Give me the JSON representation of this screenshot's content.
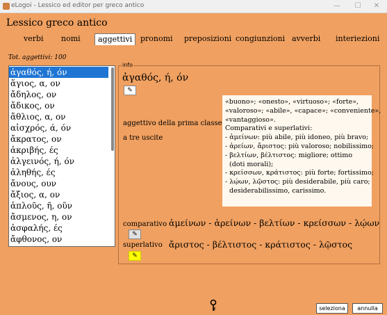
{
  "window": {
    "title": "eLogoi - Lessico ed editor per greco antico",
    "controls": [
      "—",
      "☐",
      "✕"
    ]
  },
  "page_title": "Lessico greco antico",
  "tabs": [
    {
      "label": "verbi",
      "active": false
    },
    {
      "label": "nomi",
      "active": false
    },
    {
      "label": "aggettivi",
      "active": true
    },
    {
      "label": "pronomi",
      "active": false
    },
    {
      "label": "preposizioni",
      "active": false
    },
    {
      "label": "congiunzioni",
      "active": false
    },
    {
      "label": "avverbi",
      "active": false
    },
    {
      "label": "interiezioni",
      "active": false
    }
  ],
  "count_text": "Tot. aggettivi: 100",
  "list": {
    "selected_index": 0,
    "items": [
      "ἀγαθός, ή, όν",
      "ἅγιος, α, ον",
      "ἄδηλος, ον",
      "ἄδικος, ον",
      "ἄθλιος, α, ον",
      "αἰσχρός, ά, όν",
      "ἄκρατος, ον",
      "ἀκριβής, ές",
      "ἀλγεινός, ή, όν",
      "ἀληθής, ές",
      "ἄνους, ουν",
      "ἄξιος, α, ον",
      "ἁπλοῦς, ῆ, οῦν",
      "ἄσμενος, η, ον",
      "ἀσφαλής, ές",
      "ἄφθονος, ον"
    ]
  },
  "info": {
    "frame_label": "info",
    "lemma": "ἀγαθός, ή, όν",
    "category": "aggettivo della prima classe",
    "subcategory": "a tre uscite",
    "meaning_lines": [
      "«buono»; «onesto», «virtuoso»; «forte»,",
      "«valoroso»; «abile», «capace»; «conveniente»,",
      "«vantaggioso».",
      "Comparativi e superlativi:",
      "- ἀμείνων: più abile, più idoneo, più bravo;",
      "- ἀρείων, ἄριστος: più valoroso; nobilissimo;",
      "- βελτίων, βέλτιστος: migliore; ottimo",
      "  (doti morali);",
      "- κρείσσων, κράτιστος: più forte; fortissimo;",
      "- λῴων, λῷστος: più desiderabile, più caro;",
      "  desiderabilissimo, carissimo."
    ],
    "comparativo_label": "comparativo",
    "comparativo_forms": "ἀμείνων - ἀρείνων - βελτίων - κρείσσων - λῴων",
    "superlativo_label": "superlativo",
    "superlativo_forms": "ἄριστος - βέλτιστος - κράτιστος - λῷστος"
  },
  "buttons": {
    "seleziona": "seleziona",
    "annulla": "annulla"
  },
  "colors": {
    "background": "#f0a060",
    "selection": "#1f75d3",
    "highlight_button": "#ffff00"
  },
  "icons": {
    "edit": "✎",
    "key": "key-icon"
  }
}
